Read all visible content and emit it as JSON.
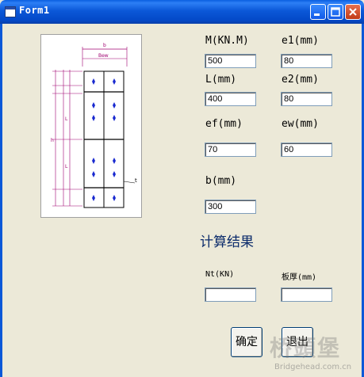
{
  "window": {
    "title": "Form1"
  },
  "diagram": {
    "labels": {
      "b": "b",
      "bew": "Bew",
      "t": "t",
      "L": "L",
      "h": "h"
    }
  },
  "fields": {
    "M": {
      "label": "M(KN.M)",
      "value": "500"
    },
    "e1": {
      "label": "e1(mm)",
      "value": "80"
    },
    "L": {
      "label": "L(mm)",
      "value": "400"
    },
    "e2": {
      "label": "e2(mm)",
      "value": "80"
    },
    "ef": {
      "label": "ef(mm)",
      "value": "70"
    },
    "ew": {
      "label": "ew(mm)",
      "value": "60"
    },
    "b": {
      "label": "b(mm)",
      "value": "300"
    }
  },
  "results": {
    "title": "计算结果",
    "nt_label": "Nt(KN)",
    "nt_value": "",
    "thickness_label": "板厚(mm)",
    "thickness_value": ""
  },
  "buttons": {
    "ok": "确定",
    "exit": "退出"
  },
  "watermark": {
    "main": "桥頭堡",
    "sub": "Bridgehead.com.cn"
  }
}
